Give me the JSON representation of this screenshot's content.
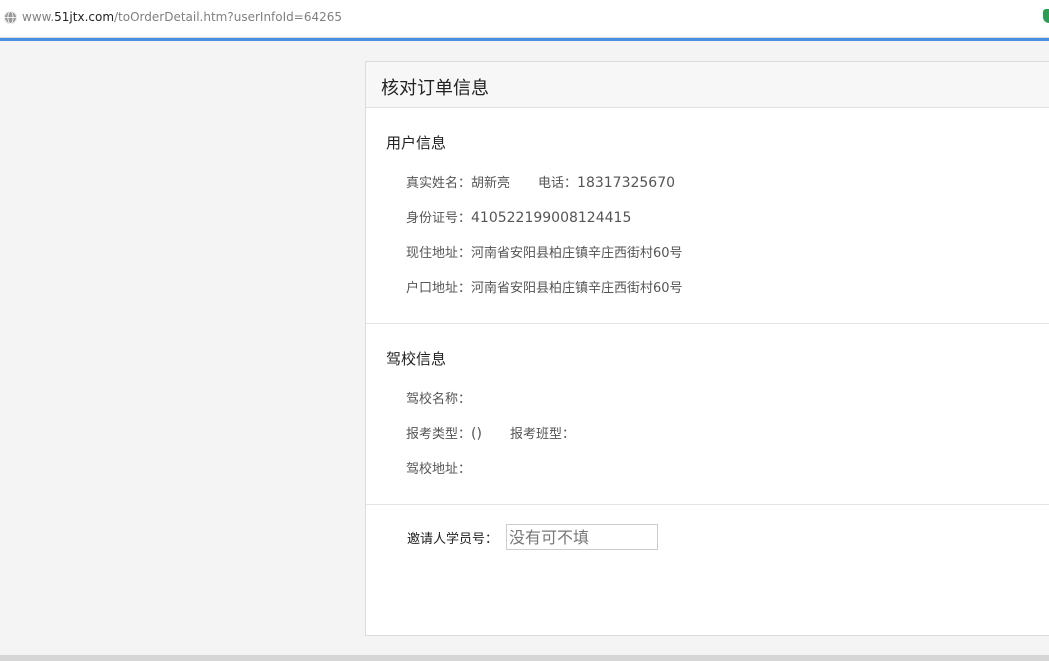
{
  "browser": {
    "url_prefix": "www.",
    "url_host": "51jtx.com",
    "url_path": "/toOrderDetail.htm?userInfoId=64265"
  },
  "page": {
    "title": "核对订单信息"
  },
  "user_info": {
    "section_title": "用户信息",
    "name_label": "真实姓名：",
    "name_value": "胡新亮",
    "phone_label": "电话：",
    "phone_value": "18317325670",
    "id_label": "身份证号：",
    "id_value": "410522199008124415",
    "current_address_label": "现住地址：",
    "current_address_value": "河南省安阳县柏庄镇辛庄西街村60号",
    "hukou_address_label": "户口地址：",
    "hukou_address_value": "河南省安阳县柏庄镇辛庄西街村60号"
  },
  "school_info": {
    "section_title": "驾校信息",
    "name_label": "驾校名称：",
    "name_value": "",
    "exam_type_label": "报考类型：",
    "exam_type_value": "()",
    "class_type_label": "报考班型：",
    "class_type_value": "",
    "address_label": "驾校地址：",
    "address_value": ""
  },
  "invite": {
    "label": "邀请人学员号：",
    "placeholder": "没有可不填",
    "value": ""
  },
  "colors": {
    "accent_rule": "#4a90e2",
    "page_bg": "#f4f4f4"
  }
}
